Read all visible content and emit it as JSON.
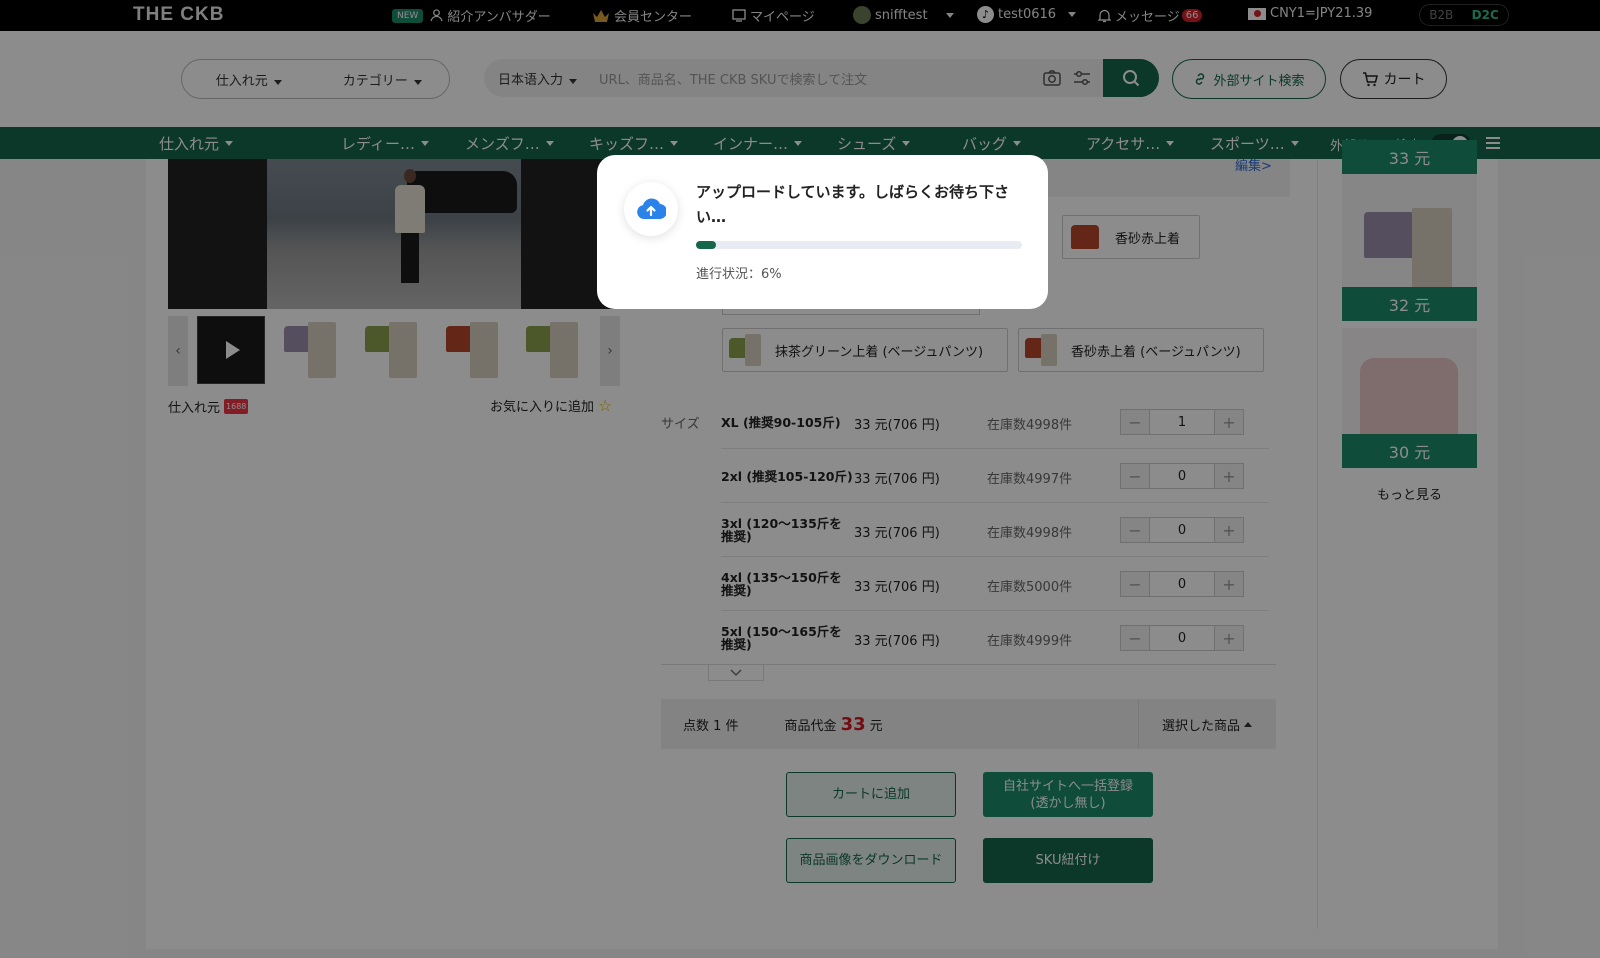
{
  "topbar": {
    "logo": "THE CKB",
    "new_badge": "NEW",
    "ambassador": "紹介アンバサダー",
    "member_center": "会員センター",
    "mypage": "マイページ",
    "user": "snifftest",
    "tiktok_account": "test0616",
    "messages": "メッセージ",
    "message_count": "66",
    "rate": "CNY1=JPY21.39",
    "mode_b2b": "B2B",
    "mode_d2c": "D2C"
  },
  "header": {
    "source_select": "仕入れ元",
    "category_select": "カテゴリー",
    "lang_select": "日本语入力",
    "search_placeholder": "URL、商品名、THE CKB SKUで検索して注文",
    "external_search": "外部サイト検索",
    "cart": "カート"
  },
  "nav": {
    "items": [
      "仕入れ元",
      "レディー…",
      "メンズフ…",
      "キッズフ…",
      "インナー…",
      "シューズ",
      "バッグ",
      "アクセサ…",
      "スポーツ…"
    ],
    "external_toggle_label": "外部サイト検索"
  },
  "product": {
    "source_label": "仕入れ元",
    "source_badge": "1688",
    "favorite": "お気に入りに追加",
    "edit_link": "編集>",
    "colors": [
      "香砂赤上着",
      "抹茶グリーン上着 (ベージュパンツ)",
      "香砂赤上着 (ベージュパンツ)"
    ],
    "size_label": "サイズ",
    "sizes": [
      {
        "name": "XL (推奨90-105斤)",
        "price": "33 元(706 円)",
        "stock": "在庫数4998件",
        "qty": "1"
      },
      {
        "name": "2xl (推奨105-120斤)",
        "price": "33 元(706 円)",
        "stock": "在庫数4997件",
        "qty": "0"
      },
      {
        "name": "3xl (120～135斤を推奨)",
        "price": "33 元(706 円)",
        "stock": "在庫数4998件",
        "qty": "0"
      },
      {
        "name": "4xl (135～150斤を推奨)",
        "price": "33 元(706 円)",
        "stock": "在庫数5000件",
        "qty": "0"
      },
      {
        "name": "5xl (150～165斤を推奨)",
        "price": "33 元(706 円)",
        "stock": "在庫数4999件",
        "qty": "0"
      }
    ],
    "count_text": "点数 1 件",
    "total_label": "商品代金",
    "total_value": "33",
    "total_unit": "元",
    "selected_items": "選択した商品",
    "btn_add_cart": "カートに追加",
    "btn_register_line1": "自社サイトへ一括登録",
    "btn_register_line2": "(透かし無し)",
    "btn_download": "商品画像をダウンロード",
    "btn_sku": "SKU紐付け"
  },
  "related": {
    "prices": [
      "33 元",
      "32 元",
      "30 元"
    ],
    "more": "もっと見る"
  },
  "modal": {
    "title": "アップロードしています。しばらくお待ち下さい…",
    "progress_label": "進行状況：6%",
    "progress_fraction": 0.06
  },
  "colors": {
    "brand_green": "#16664b",
    "accent_red": "#d1191f"
  }
}
